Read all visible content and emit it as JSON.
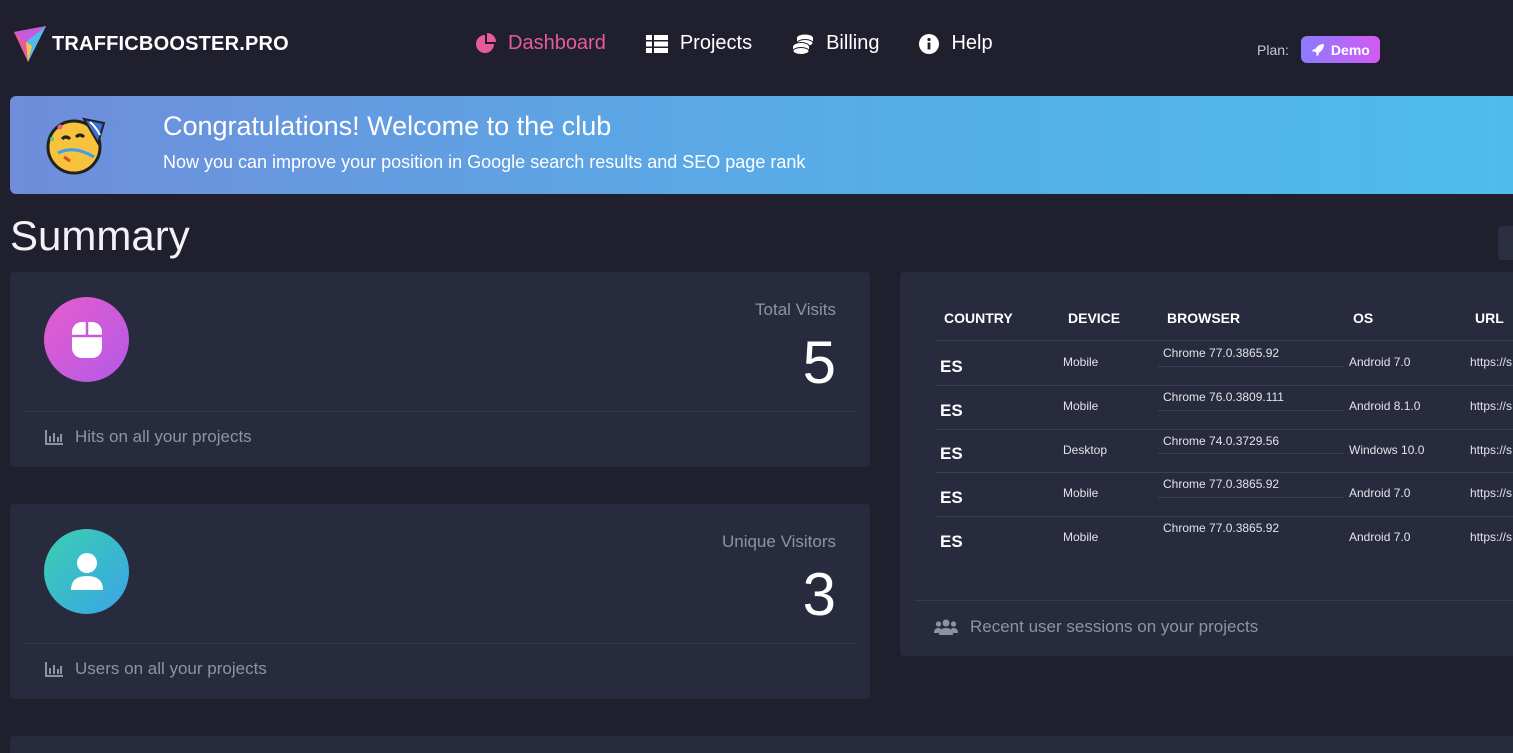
{
  "brand": {
    "name": "TRAFFICBOOSTER.PRO"
  },
  "nav": {
    "items": [
      {
        "label": "Dashboard",
        "icon": "pie-chart-icon",
        "active": true
      },
      {
        "label": "Projects",
        "icon": "table-icon",
        "active": false
      },
      {
        "label": "Billing",
        "icon": "coins-icon",
        "active": false
      },
      {
        "label": "Help",
        "icon": "info-icon",
        "active": false
      }
    ]
  },
  "plan": {
    "label": "Plan:",
    "value": "Demo",
    "icon": "rocket-icon"
  },
  "banner": {
    "title": "Congratulations! Welcome to the club",
    "subtitle": "Now you can improve your position in Google search results and SEO page rank",
    "icon": "party-face-icon"
  },
  "summary": {
    "title": "Summary",
    "visits": {
      "label": "Total Visits",
      "value": "5",
      "footer": "Hits on all your projects",
      "icon": "mouse-icon"
    },
    "visitors": {
      "label": "Unique Visitors",
      "value": "3",
      "footer": "Users on all your projects",
      "icon": "user-icon"
    }
  },
  "sessions": {
    "columns": [
      "COUNTRY",
      "DEVICE",
      "BROWSER",
      "OS",
      "URL"
    ],
    "rows": [
      {
        "country": "ES",
        "device": "Mobile",
        "browser": "Chrome 77.0.3865.92",
        "os": "Android 7.0",
        "url": "https://s"
      },
      {
        "country": "ES",
        "device": "Mobile",
        "browser": "Chrome 76.0.3809.111",
        "os": "Android 8.1.0",
        "url": "https://s"
      },
      {
        "country": "ES",
        "device": "Desktop",
        "browser": "Chrome 74.0.3729.56",
        "os": "Windows 10.0",
        "url": "https://s"
      },
      {
        "country": "ES",
        "device": "Mobile",
        "browser": "Chrome 77.0.3865.92",
        "os": "Android 7.0",
        "url": "https://s"
      },
      {
        "country": "ES",
        "device": "Mobile",
        "browser": "Chrome 77.0.3865.92",
        "os": "Android 7.0",
        "url": "https://s"
      }
    ],
    "footer": "Recent user sessions on your projects",
    "footer_icon": "users-icon"
  },
  "colors": {
    "accent": "#e75b9a",
    "background": "#1f1f2d",
    "card": "#282b3e"
  }
}
